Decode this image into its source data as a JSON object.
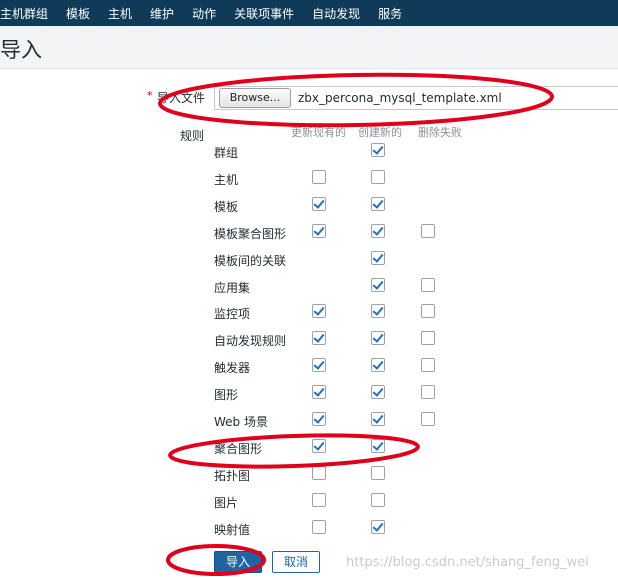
{
  "nav": {
    "items": [
      "主机群组",
      "模板",
      "主机",
      "维护",
      "动作",
      "关联项事件",
      "自动发现",
      "服务"
    ]
  },
  "page": {
    "title": "导入"
  },
  "form": {
    "file_label": "导入文件",
    "required_mark": "*",
    "browse_label": "Browse...",
    "file_name": "zbx_percona_mysql_template.xml",
    "rules_label": "规则",
    "col_headers": [
      "更新现有的",
      "创建新的",
      "删除失败"
    ]
  },
  "rules": [
    {
      "name": "群组",
      "update": null,
      "create": true,
      "delete": null
    },
    {
      "name": "主机",
      "update": false,
      "create": false,
      "delete": null
    },
    {
      "name": "模板",
      "update": true,
      "create": true,
      "delete": null
    },
    {
      "name": "模板聚合图形",
      "update": true,
      "create": true,
      "delete": false
    },
    {
      "name": "模板间的关联",
      "update": null,
      "create": true,
      "delete": null
    },
    {
      "name": "应用集",
      "update": null,
      "create": true,
      "delete": false
    },
    {
      "name": "监控项",
      "update": true,
      "create": true,
      "delete": false
    },
    {
      "name": "自动发现规则",
      "update": true,
      "create": true,
      "delete": false
    },
    {
      "name": "触发器",
      "update": true,
      "create": true,
      "delete": false
    },
    {
      "name": "图形",
      "update": true,
      "create": true,
      "delete": false
    },
    {
      "name": "Web 场景",
      "update": true,
      "create": true,
      "delete": false
    },
    {
      "name": "聚合图形",
      "update": true,
      "create": true,
      "delete": null
    },
    {
      "name": "拓扑图",
      "update": false,
      "create": false,
      "delete": null
    },
    {
      "name": "图片",
      "update": false,
      "create": false,
      "delete": null
    },
    {
      "name": "映射值",
      "update": false,
      "create": true,
      "delete": null
    }
  ],
  "buttons": {
    "import": "导入",
    "cancel": "取消"
  },
  "watermark": "https://blog.csdn.net/shang_feng_wei",
  "colors": {
    "nav_bg": "#0f3b58",
    "accent": "#1f65a6",
    "annotation": "#e0001b"
  }
}
